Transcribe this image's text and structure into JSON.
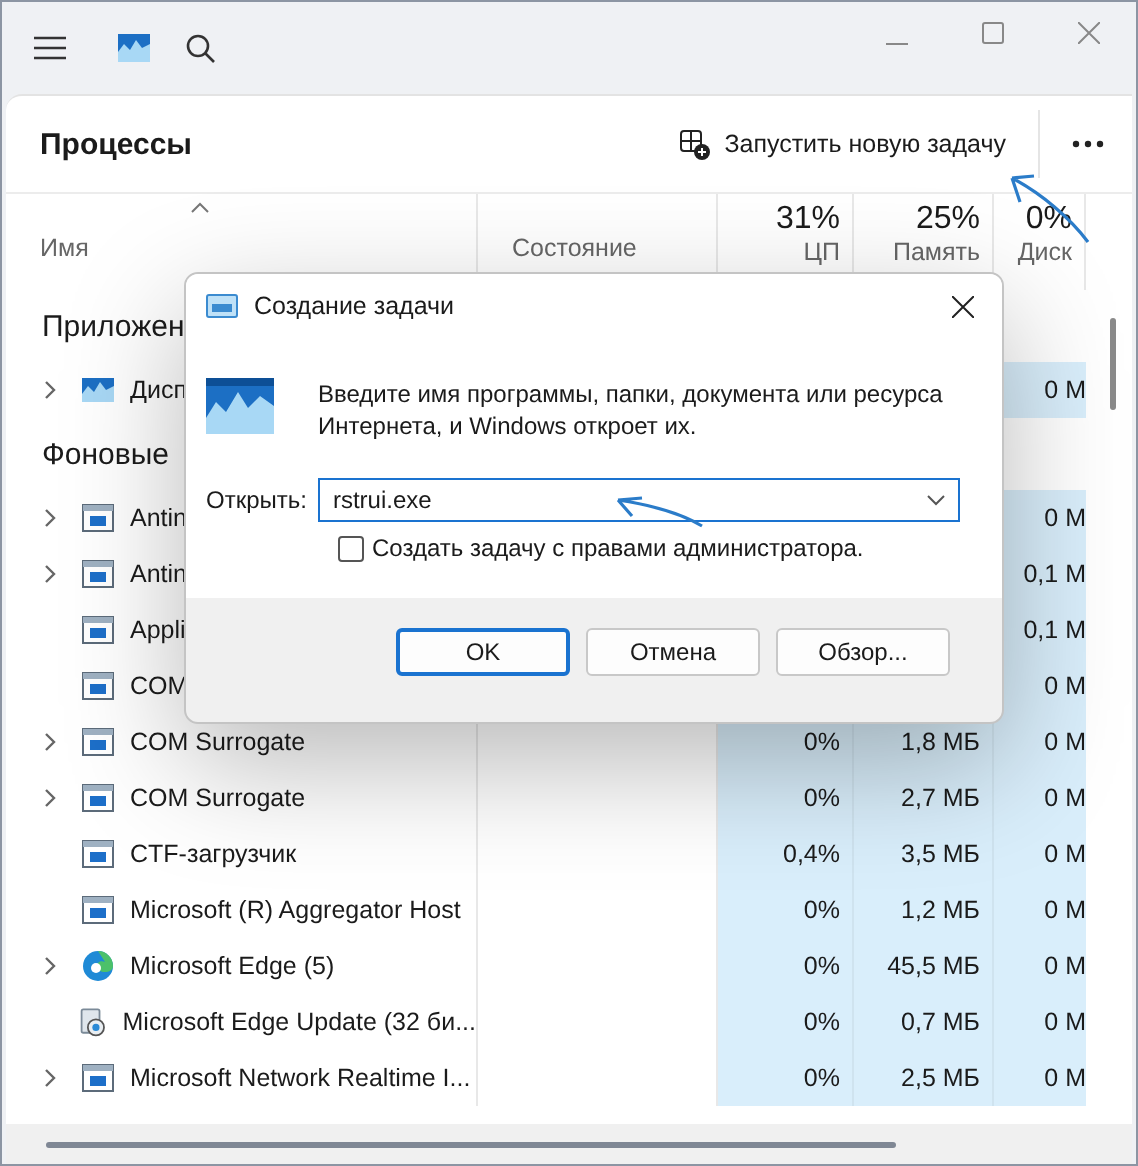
{
  "toolbar": {
    "title": "Процессы",
    "action": "Запустить новую задачу"
  },
  "columns": [
    {
      "label": "Имя",
      "sorted": true
    },
    {
      "label": "Состояние",
      "sorted": false
    },
    {
      "percent": "31%",
      "label": "ЦП",
      "sorted": false
    },
    {
      "percent": "25%",
      "label": "Память",
      "sorted": false
    },
    {
      "percent": "0%",
      "label": "Диск",
      "sorted": false
    }
  ],
  "rows": [
    {
      "kind": "group",
      "name": "Приложен"
    },
    {
      "kind": "monitor",
      "name": "Дисп",
      "expandable": true,
      "disk": "0 М"
    },
    {
      "kind": "group",
      "name": "Фоновые"
    },
    {
      "kind": "window",
      "name": "Antin",
      "expandable": true,
      "disk": "0 М"
    },
    {
      "kind": "window",
      "name": "Antin",
      "expandable": true,
      "disk": "0,1 М"
    },
    {
      "kind": "window",
      "name": "Appli",
      "expandable": false,
      "disk": "0,1 М"
    },
    {
      "kind": "window",
      "name": "COM",
      "expandable": false,
      "disk": "0 М"
    },
    {
      "kind": "window",
      "name": "COM Surrogate",
      "expandable": true,
      "cpu": "0%",
      "memory": "1,8 МБ",
      "disk": "0 М"
    },
    {
      "kind": "window",
      "name": "COM Surrogate",
      "expandable": true,
      "cpu": "0%",
      "memory": "2,7 МБ",
      "disk": "0 М"
    },
    {
      "kind": "window",
      "name": "CTF-загрузчик",
      "expandable": false,
      "cpu": "0,4%",
      "memory": "3,5 МБ",
      "disk": "0 М"
    },
    {
      "kind": "window",
      "name": "Microsoft (R) Aggregator Host",
      "expandable": false,
      "cpu": "0%",
      "memory": "1,2 МБ",
      "disk": "0 М"
    },
    {
      "kind": "edge",
      "name": "Microsoft Edge (5)",
      "expandable": true,
      "cpu": "0%",
      "memory": "45,5 МБ",
      "disk": "0 М"
    },
    {
      "kind": "installer",
      "name": "Microsoft Edge Update (32 би...",
      "expandable": false,
      "cpu": "0%",
      "memory": "0,7 МБ",
      "disk": "0 М"
    },
    {
      "kind": "window",
      "name": "Microsoft Network Realtime I...",
      "expandable": true,
      "cpu": "0%",
      "memory": "2,5 МБ",
      "disk": "0 М"
    }
  ],
  "dialog": {
    "title": "Создание задачи",
    "message": "Введите имя программы, папки, документа или ресурса Интернета, и Windows откроет их.",
    "open_label": "Открыть:",
    "value": "rstrui.exe",
    "admin_checkbox": {
      "label": "Создать задачу с правами администратора.",
      "checked": false
    },
    "buttons": [
      {
        "label": "OK",
        "default": true
      },
      {
        "label": "Отмена",
        "default": false
      },
      {
        "label": "Обзор...",
        "default": false
      }
    ]
  }
}
